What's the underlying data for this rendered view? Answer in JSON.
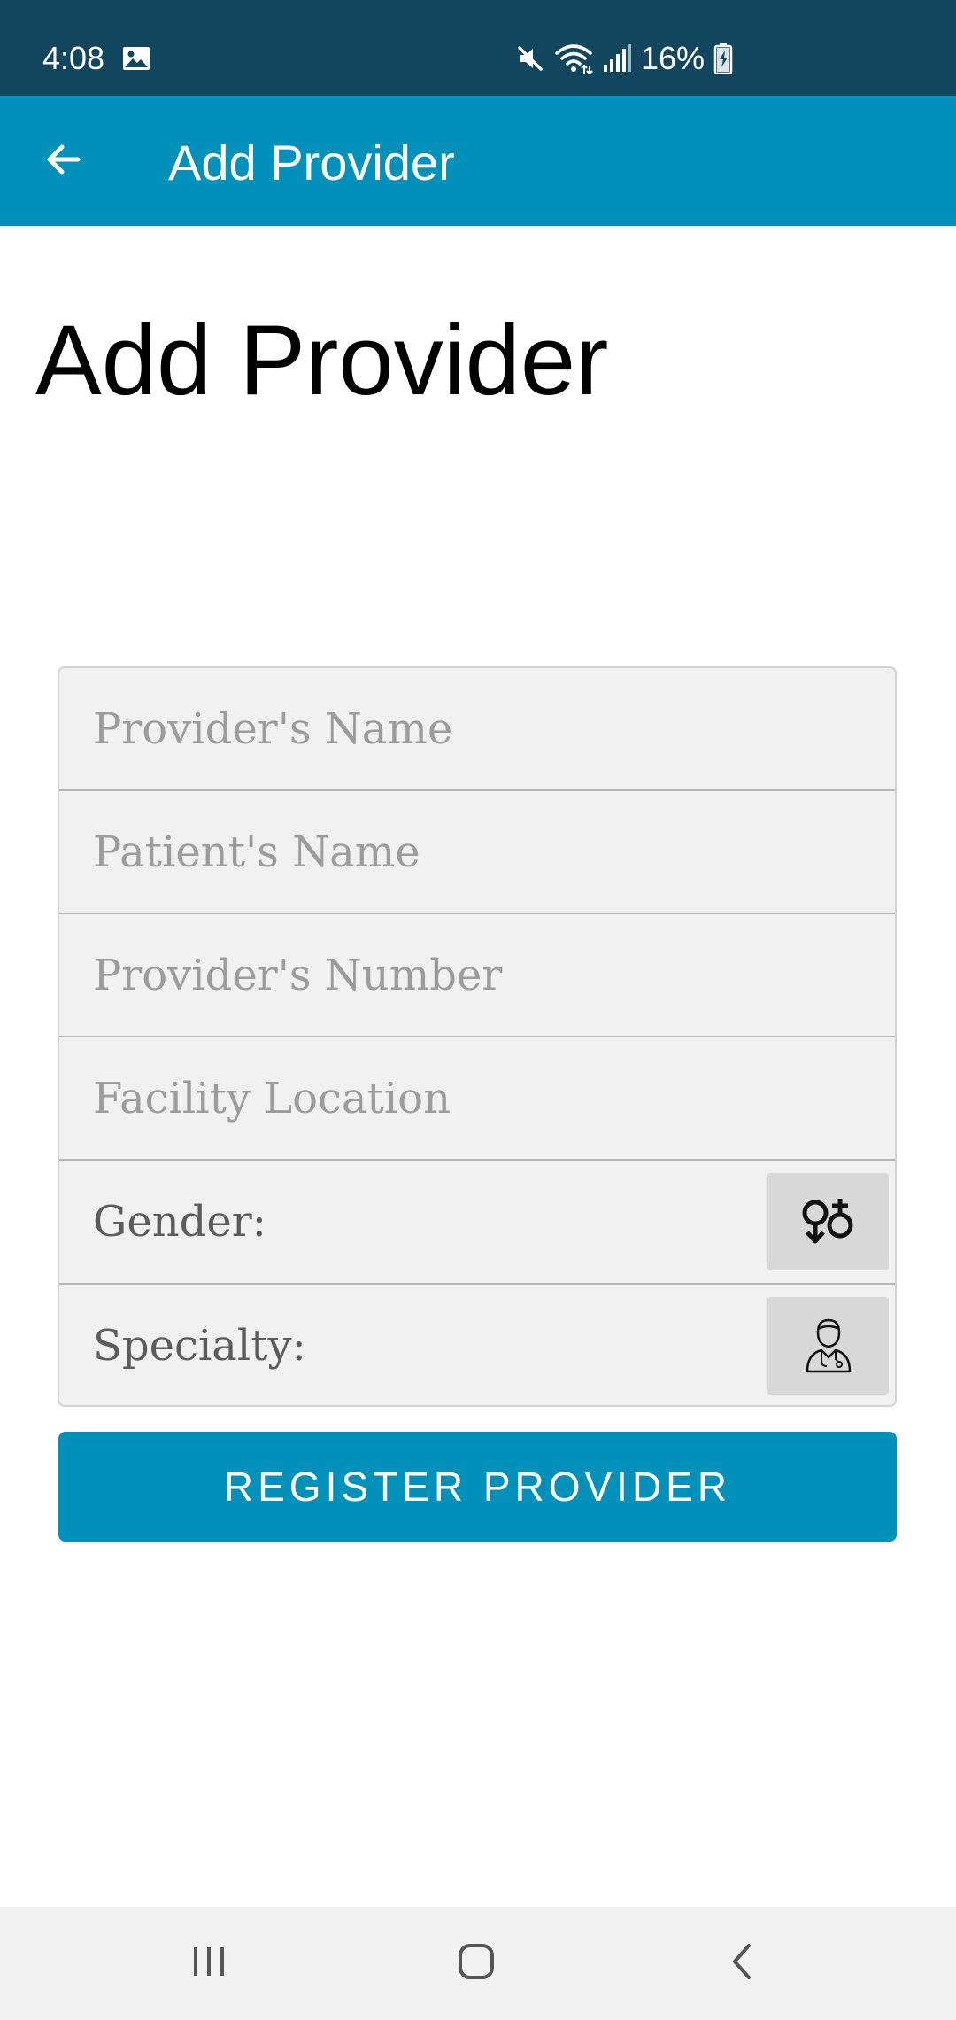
{
  "status_bar": {
    "time": "4:08",
    "battery": "16%",
    "icons": [
      "gallery-icon",
      "mute-icon",
      "wifi-icon",
      "signal-icon",
      "battery-icon"
    ]
  },
  "app_bar": {
    "title": "Add Provider",
    "back_icon": "arrow-left-icon"
  },
  "page": {
    "title": "Add Provider"
  },
  "form": {
    "provider_name": {
      "placeholder": "Provider's Name",
      "value": ""
    },
    "patient_name": {
      "placeholder": "Patient's Name",
      "value": ""
    },
    "provider_number": {
      "placeholder": "Provider's Number",
      "value": ""
    },
    "facility_location": {
      "placeholder": "Facility Location",
      "value": ""
    },
    "gender": {
      "label": "Gender:",
      "icon": "gender-icon"
    },
    "specialty": {
      "label": "Specialty:",
      "icon": "doctor-icon"
    }
  },
  "register_button": {
    "label": "REGISTER PROVIDER"
  },
  "nav_bar": {
    "icons": [
      "recent-apps-icon",
      "home-icon",
      "back-icon"
    ]
  },
  "colors": {
    "status_bar": "#12465e",
    "primary": "#0090b9",
    "form_background": "#f1f1f1",
    "placeholder_text": "#9c9c9c"
  }
}
